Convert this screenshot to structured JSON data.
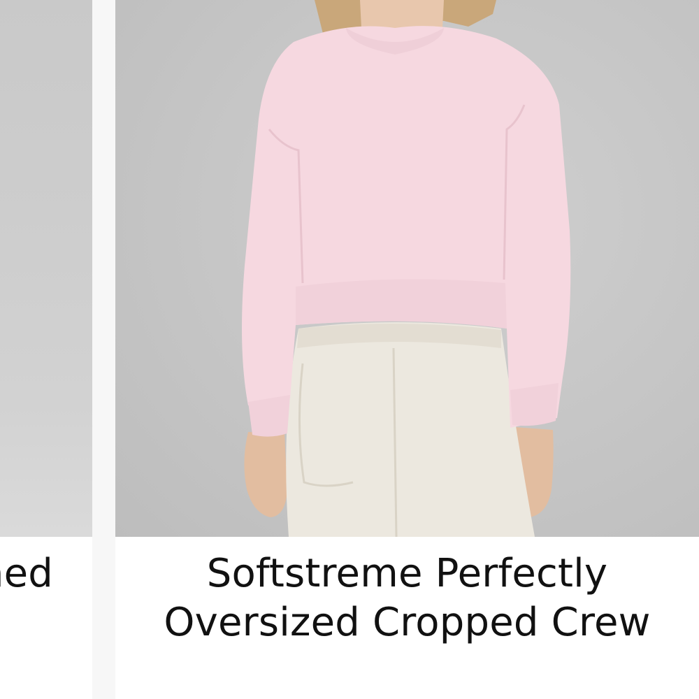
{
  "products": {
    "previous": {
      "title": "Quilted Relaxed-Fit Crew Washed",
      "image_alt": "previous product photo"
    },
    "current": {
      "title": "Softstreme Perfectly Oversized Cropped Crew",
      "image_alt": "model wearing pink cropped crewneck sweatshirt with light joggers",
      "sweatshirt_color": "#f6d8e0",
      "pants_color": "#ece8df"
    }
  }
}
